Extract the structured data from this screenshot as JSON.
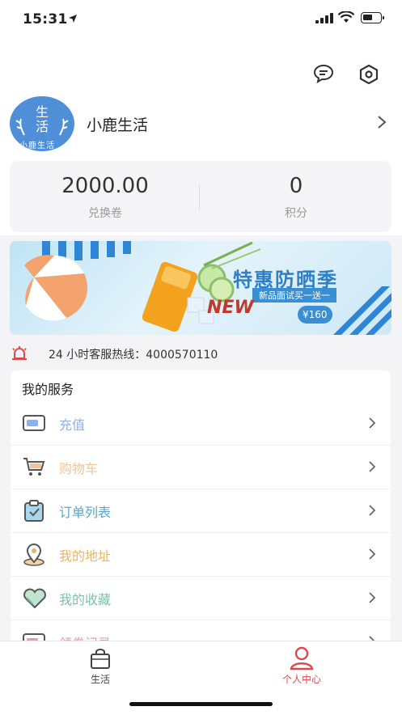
{
  "status": {
    "time": "15:31"
  },
  "header": {
    "username": "小鹿生活",
    "avatar_text": {
      "line1": "生",
      "line2": "活",
      "line3": "小鹿生活"
    }
  },
  "stats": [
    {
      "value": "2000.00",
      "label": "兑换卷"
    },
    {
      "value": "0",
      "label": "积分"
    }
  ],
  "banner": {
    "title": "特惠防晒季",
    "subtitle": "新品面试买一送一",
    "tag": "NEW",
    "price": "¥160"
  },
  "hotline": {
    "text": "24 小时客服热线：4000570110"
  },
  "services": {
    "title": "我的服务",
    "items": [
      {
        "label": "充值",
        "color": "#8fb0e8"
      },
      {
        "label": "购物车",
        "color": "#f0c49a"
      },
      {
        "label": "订单列表",
        "color": "#5aa6cc"
      },
      {
        "label": "我的地址",
        "color": "#e8b46a"
      },
      {
        "label": "我的收藏",
        "color": "#7cc3a3"
      },
      {
        "label": "领券记录",
        "color": "#ef9aa8"
      }
    ]
  },
  "tabbar": {
    "tabs": [
      {
        "label": "生活",
        "active": false
      },
      {
        "label": "个人中心",
        "active": true
      }
    ],
    "active_color": "#e0464d"
  }
}
